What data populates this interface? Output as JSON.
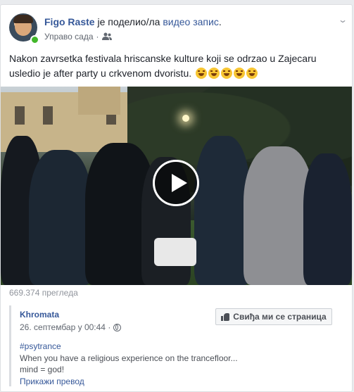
{
  "post": {
    "author": "Figo Raste",
    "action_text": " је поделио/ла ",
    "shared_link": "видео запис",
    "action_end": ".",
    "timestamp": "Управо сада",
    "audience_icon": "friends-icon",
    "text": "Nakon zavrsetka festivala hriscanske kulture koji se odrzao u Zajecaru usledio je after party u crkvenom dvoristu.",
    "emoji_count": 5,
    "emoji_icon": "laughing-tears-emoji"
  },
  "video": {
    "play_icon": "play-icon",
    "views": "669.374 прегледа"
  },
  "shared_from": {
    "page_name": "Khromata",
    "date": "26. септембар у 00:44 · ",
    "privacy_icon": "globe-icon",
    "like_page_button": "Свиђа ми се страница",
    "hashtag": "#psytrance",
    "description_line1": "When you have a religious experience on the trancefloor...",
    "description_line2": "mind = god!",
    "translate_link": "Прикажи превод"
  },
  "colors": {
    "link": "#365899",
    "online": "#42b72a",
    "background": "#e9ebee"
  }
}
